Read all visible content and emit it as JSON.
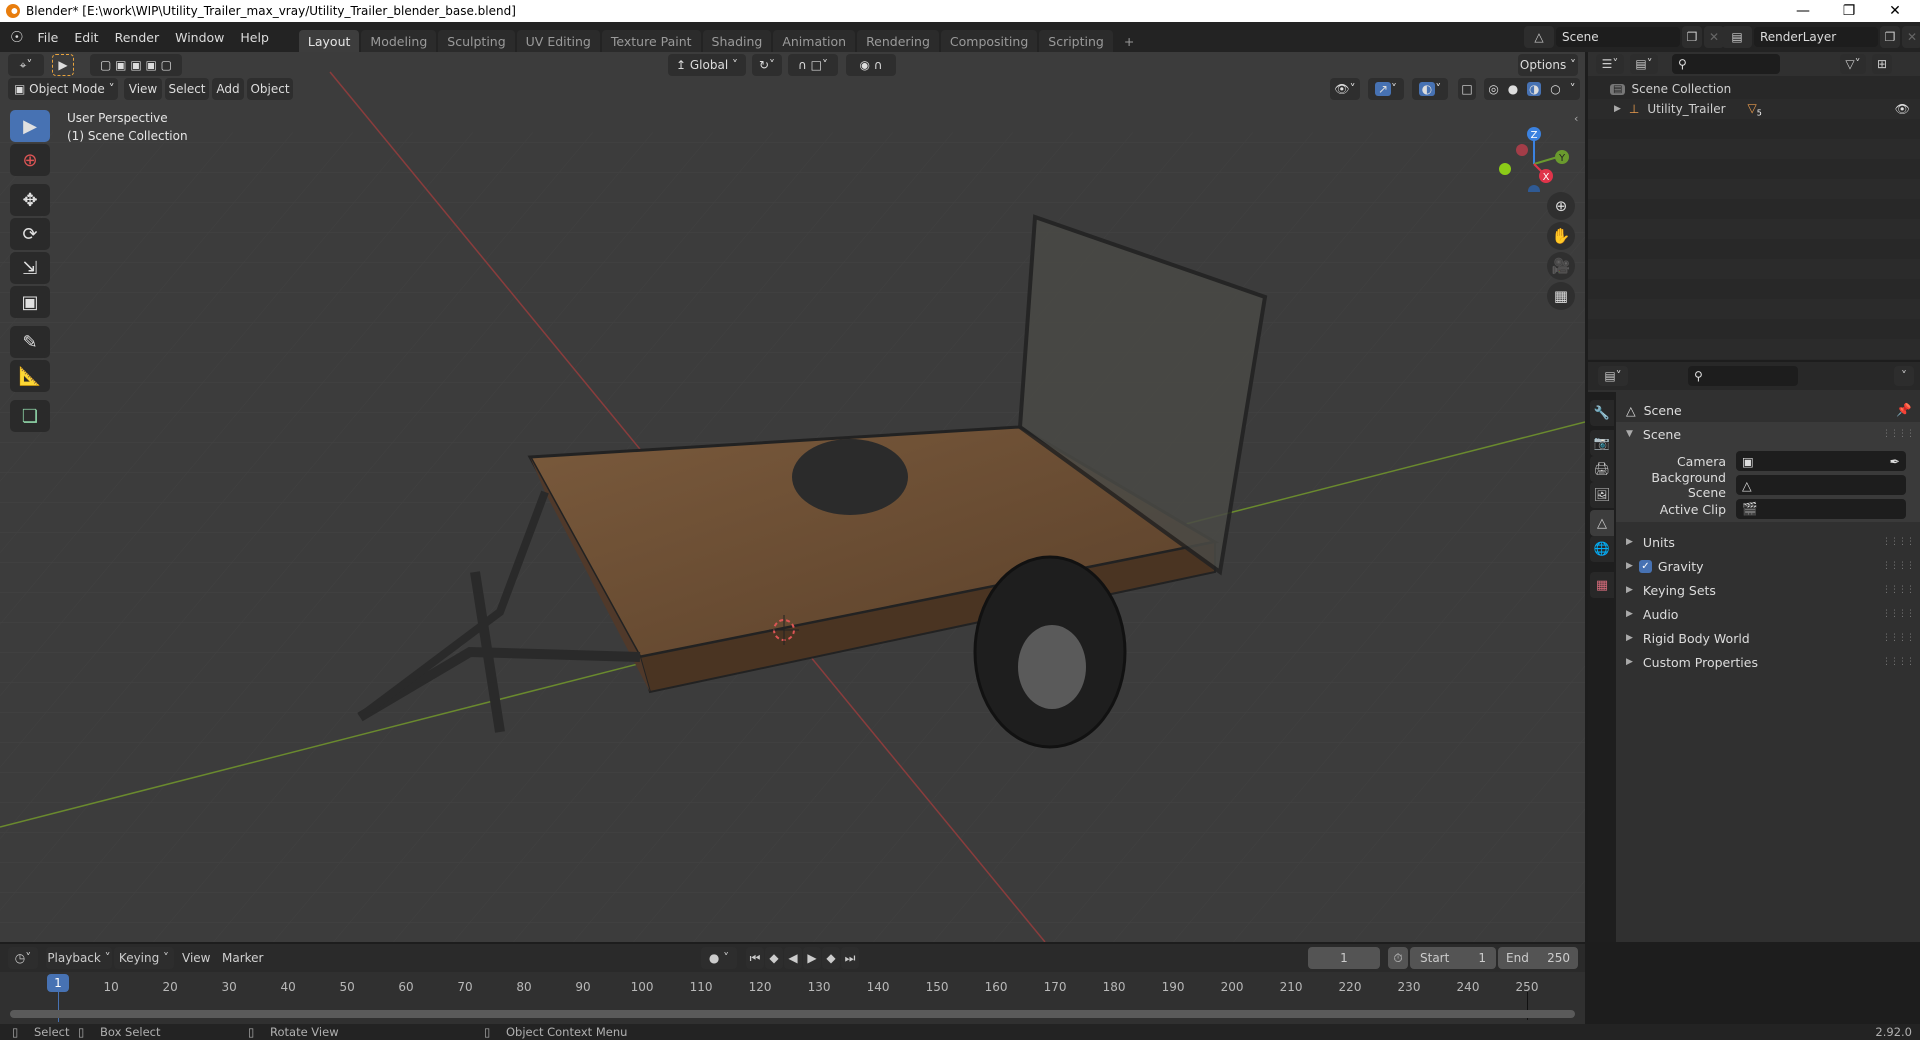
{
  "window": {
    "title": "Blender* [E:\\work\\WIP\\Utility_Trailer_max_vray/Utility_Trailer_blender_base.blend]",
    "controls": [
      "minimize",
      "restore",
      "close"
    ]
  },
  "topbar": {
    "menus": [
      "File",
      "Edit",
      "Render",
      "Window",
      "Help"
    ],
    "workspaces": [
      "Layout",
      "Modeling",
      "Sculpting",
      "UV Editing",
      "Texture Paint",
      "Shading",
      "Animation",
      "Rendering",
      "Compositing",
      "Scripting"
    ],
    "active_workspace": "Layout",
    "add_workspace": "+",
    "scene_name": "Scene",
    "view_layer": "RenderLayer"
  },
  "viewport": {
    "mode": "Object Mode",
    "menus": [
      "View",
      "Select",
      "Add",
      "Object"
    ],
    "transform_orientation": "Global",
    "options_label": "Options",
    "overlay_line1": "User Perspective",
    "overlay_line2": "(1) Scene Collection",
    "tools": [
      "select-box",
      "cursor",
      "move",
      "rotate",
      "scale",
      "transform",
      "annotate",
      "measure",
      "add-cube"
    ],
    "gizmo_axes": [
      "Z",
      "Y",
      "X"
    ],
    "accent": "#4772b3"
  },
  "outliner": {
    "root": "Scene Collection",
    "items": [
      {
        "name": "Utility_Trailer",
        "children_count": "5"
      }
    ]
  },
  "properties": {
    "context": "Scene",
    "section": "Scene",
    "fields": [
      {
        "label": "Camera",
        "value": ""
      },
      {
        "label": "Background Scene",
        "value": ""
      },
      {
        "label": "Active Clip",
        "value": ""
      }
    ],
    "panels": [
      {
        "label": "Units",
        "checkbox": false
      },
      {
        "label": "Gravity",
        "checkbox": true
      },
      {
        "label": "Keying Sets",
        "checkbox": false
      },
      {
        "label": "Audio",
        "checkbox": false
      },
      {
        "label": "Rigid Body World",
        "checkbox": false
      },
      {
        "label": "Custom Properties",
        "checkbox": false
      }
    ]
  },
  "timeline": {
    "menus": [
      "Playback",
      "Keying",
      "View",
      "Marker"
    ],
    "current_frame": "1",
    "start_label": "Start",
    "start": "1",
    "end_label": "End",
    "end": "250",
    "ticks": [
      "10",
      "20",
      "30",
      "40",
      "50",
      "60",
      "70",
      "80",
      "90",
      "100",
      "110",
      "120",
      "130",
      "140",
      "150",
      "160",
      "170",
      "180",
      "190",
      "200",
      "210",
      "220",
      "230",
      "240",
      "250"
    ]
  },
  "statusbar": {
    "hints": [
      "Select",
      "Box Select",
      "Rotate View",
      "Object Context Menu"
    ],
    "version": "2.92.0"
  }
}
